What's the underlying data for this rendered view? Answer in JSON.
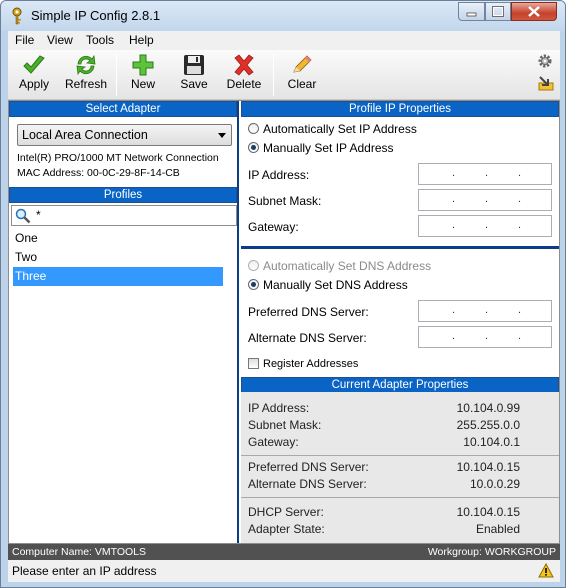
{
  "window": {
    "title": "Simple IP Config 2.8.1",
    "controls": [
      "minimize",
      "maximize",
      "close"
    ]
  },
  "menu": [
    "File",
    "View",
    "Tools",
    "Help"
  ],
  "toolbar": {
    "apply": {
      "label": "Apply",
      "icon": "checkmark-icon"
    },
    "refresh": {
      "label": "Refresh",
      "icon": "refresh-icon"
    },
    "new": {
      "label": "New",
      "icon": "plus-icon"
    },
    "save": {
      "label": "Save",
      "icon": "floppy-icon"
    },
    "delete": {
      "label": "Delete",
      "icon": "x-icon"
    },
    "clear": {
      "label": "Clear",
      "icon": "pencil-icon"
    }
  },
  "select_adapter": {
    "header": "Select Adapter",
    "selected": "Local Area Connection",
    "description": "Intel(R) PRO/1000 MT Network Connection",
    "mac": "MAC Address: 00-0C-29-8F-14-CB"
  },
  "profiles": {
    "header": "Profiles",
    "search_value": "*",
    "items": [
      {
        "label": "One",
        "selected": false
      },
      {
        "label": "Two",
        "selected": false
      },
      {
        "label": "Three",
        "selected": true
      }
    ]
  },
  "profile_ip": {
    "header": "Profile IP Properties",
    "auto_ip": "Automatically Set IP Address",
    "manual_ip": "Manually Set IP Address",
    "ip_label": "IP Address:",
    "subnet_label": "Subnet Mask:",
    "gateway_label": "Gateway:",
    "ip_placeholder": ".     .     .",
    "auto_dns": "Automatically Set DNS Address",
    "manual_dns": "Manually Set DNS Address",
    "pref_dns_label": "Preferred DNS Server:",
    "alt_dns_label": "Alternate DNS Server:",
    "register": "Register Addresses"
  },
  "current": {
    "header": "Current Adapter Properties",
    "ip_label": "IP Address:",
    "ip": "10.104.0.99",
    "subnet_label": "Subnet Mask:",
    "subnet": "255.255.0.0",
    "gateway_label": "Gateway:",
    "gateway": "10.104.0.1",
    "pref_dns_label": "Preferred DNS Server:",
    "pref_dns": "10.104.0.15",
    "alt_dns_label": "Alternate DNS Server:",
    "alt_dns": "10.0.0.29",
    "dhcp_label": "DHCP Server:",
    "dhcp": "10.104.0.15",
    "state_label": "Adapter State:",
    "state": "Enabled"
  },
  "footer": {
    "computer": "Computer Name: VMTOOLS",
    "workgroup": "Workgroup: WORKGROUP",
    "status": "Please enter an IP address"
  }
}
